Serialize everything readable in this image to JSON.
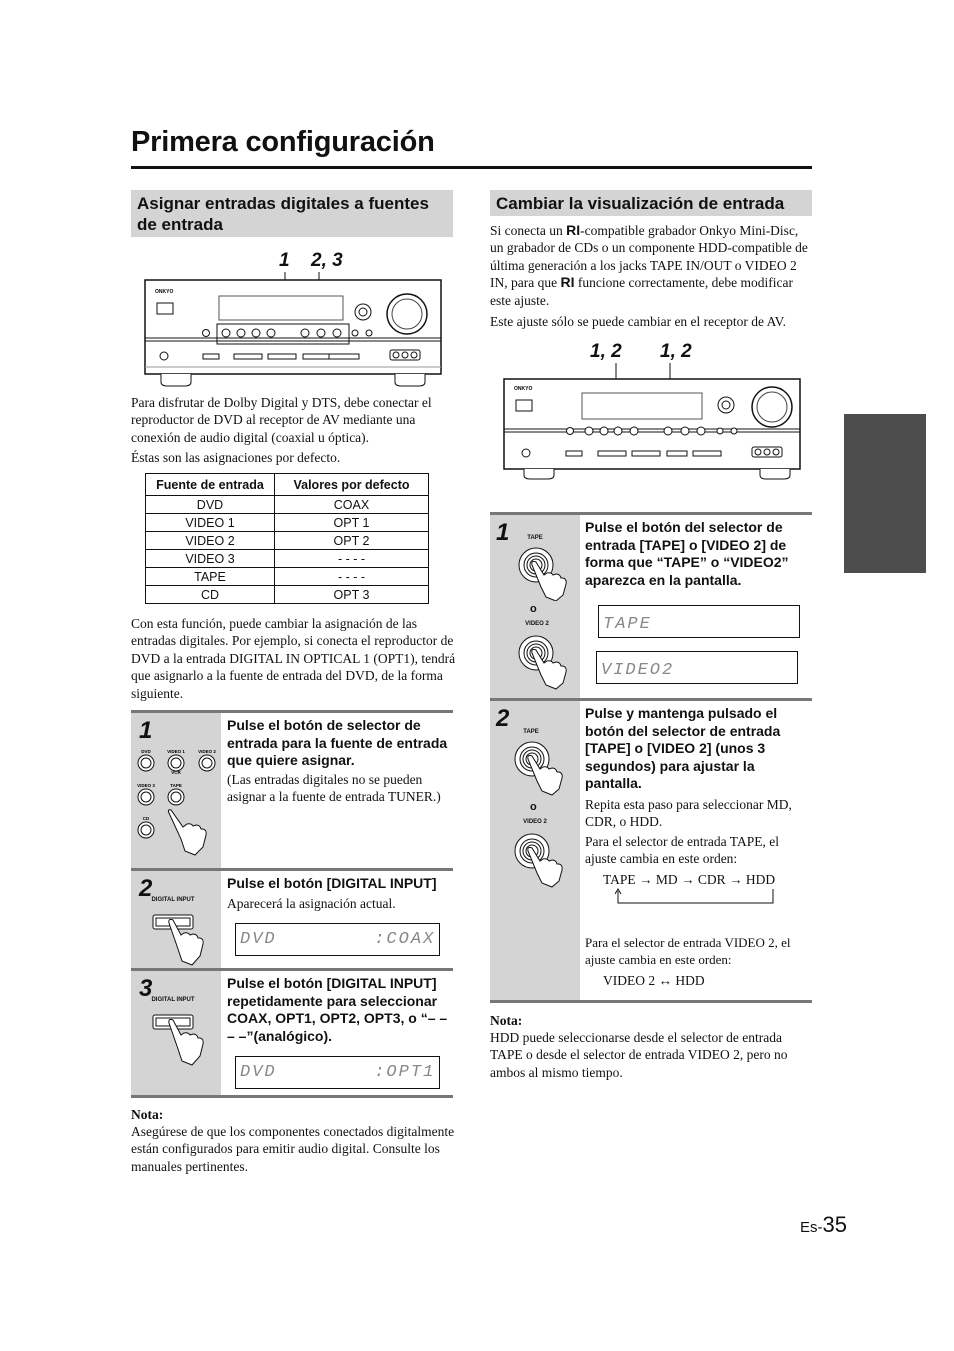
{
  "page": {
    "title": "Primera configuración",
    "page_prefix": "Es-",
    "page_number": "35"
  },
  "left": {
    "heading": "Asignar entradas digitales a fuentes de entrada",
    "figure_labels": [
      "1",
      "2, 3"
    ],
    "intro": "Para disfrutar de Dolby Digital y DTS, debe conectar el reproductor de DVD al receptor de AV mediante una conexión de audio digital (coaxial u óptica).",
    "intro2": "Éstas son las asignaciones por defecto.",
    "table": {
      "headers": [
        "Fuente de entrada",
        "Valores por defecto"
      ],
      "rows": [
        [
          "DVD",
          "COAX"
        ],
        [
          "VIDEO 1",
          "OPT 1"
        ],
        [
          "VIDEO 2",
          "OPT 2"
        ],
        [
          "VIDEO 3",
          "- - - -"
        ],
        [
          "TAPE",
          "- - - -"
        ],
        [
          "CD",
          "OPT 3"
        ]
      ]
    },
    "paragraph": "Con esta función, puede cambiar la asignación de las entradas digitales. Por ejemplo, si conecta el reproductor de DVD a la entrada DIGITAL IN OPTICAL 1 (OPT1), tendrá que asignarlo a la fuente de entrada del DVD, de la forma siguiente.",
    "steps": [
      {
        "number": "1",
        "heading": "Pulse el botón de selector de entrada para la fuente de entrada que quiere asignar.",
        "text": "(Las entradas digitales no se pueden asignar a la fuente de entrada TUNER.)",
        "buttons": [
          "DVD",
          "VIDEO 1",
          "VIDEO 2",
          "VIDEO 3",
          "TAPE",
          "CD"
        ],
        "button_sublabel": "VCR"
      },
      {
        "number": "2",
        "heading": "Pulse el botón [DIGITAL INPUT]",
        "text": "Aparecerá la asignación actual.",
        "button_label": "DIGITAL INPUT",
        "display": "DVD        :COAX"
      },
      {
        "number": "3",
        "heading": "Pulse el botón [DIGITAL INPUT] repetidamente para seleccionar COAX, OPT1, OPT2, OPT3, o “– – – –”(analógico).",
        "button_label": "DIGITAL INPUT",
        "display": "DVD        :OPT1"
      }
    ],
    "note_title": "Nota:",
    "note": "Asegúrese de que los componentes conectados digitalmente están configurados para emitir audio digital. Consulte los manuales pertinentes."
  },
  "right": {
    "heading": "Cambiar la visualización de entrada",
    "intro_a": "Si conecta un ",
    "ri_logo": "RI",
    "intro_b": "-compatible grabador Onkyo Mini-Disc, un grabador de CDs o un componente HDD-compatible de última generación a los jacks TAPE IN/OUT o VIDEO 2 IN, para que ",
    "intro_c": " funcione correctamente, debe modificar este ajuste.",
    "intro2": "Este ajuste sólo se puede cambiar en el receptor de AV.",
    "figure_labels": [
      "1, 2",
      "1, 2"
    ],
    "brand": "ONKYO",
    "steps": [
      {
        "number": "1",
        "heading": "Pulse el botón del selector de entrada [TAPE] o [VIDEO 2] de forma que “TAPE” o “VIDEO2” aparezca en la pantalla.",
        "button_top": "TAPE",
        "or": "o",
        "button_bottom": "VIDEO 2",
        "display1": "TAPE",
        "display2": "VIDEO2"
      },
      {
        "number": "2",
        "heading": "Pulse y mantenga pulsado el botón del selector de entrada [TAPE] o [VIDEO 2] (unos 3 segundos) para ajustar la pantalla.",
        "text1": "Repita esta paso para seleccionar MD, CDR, o HDD.",
        "text2": "Para el selector de entrada TAPE, el ajuste cambia en este orden:",
        "sequence": "TAPE → MD → CDR → HDD",
        "text3": "Para el selector de entrada VIDEO 2, el ajuste cambia en este orden:",
        "sequence2": "VIDEO 2 ↔ HDD",
        "button_top": "TAPE",
        "or": "o",
        "button_bottom": "VIDEO 2"
      }
    ],
    "note_title": "Nota:",
    "note": "HDD puede seleccionarse desde el selector de entrada TAPE o desde el selector de entrada VIDEO 2, pero no ambos al mismo tiempo."
  }
}
